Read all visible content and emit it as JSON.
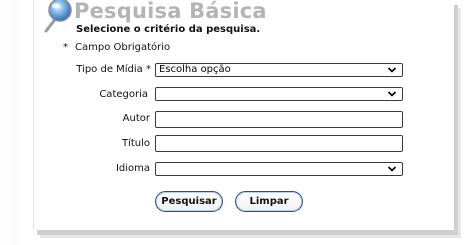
{
  "header": {
    "title": "Pesquisa Básica",
    "subtitle": "Selecione o critério da pesquisa.",
    "icon": "magnifier-icon"
  },
  "required_note": {
    "star": "*",
    "text": "Campo Obrigatório"
  },
  "form": {
    "media_type": {
      "label": "Tipo de Mídia *",
      "value": "Escolha opção"
    },
    "category": {
      "label": "Categoria",
      "value": ""
    },
    "author": {
      "label": "Autor",
      "value": ""
    },
    "title": {
      "label": "Título",
      "value": ""
    },
    "language": {
      "label": "Idioma",
      "value": ""
    }
  },
  "buttons": {
    "search": "Pesquisar",
    "clear": "Limpar"
  },
  "colors": {
    "title": "#b4b4b4",
    "button_border": "#2c4f86",
    "accent": "#4a90d9"
  }
}
